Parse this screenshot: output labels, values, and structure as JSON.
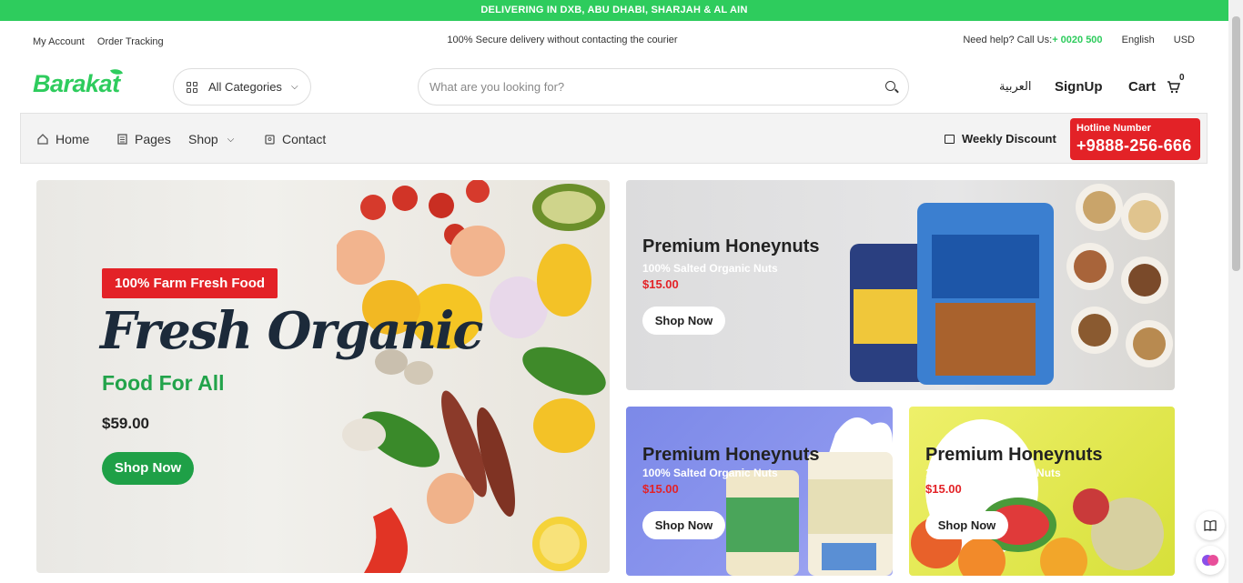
{
  "announcement": "DELIVERING IN DXB, ABU DHABI, SHARJAH & AL AIN",
  "topbar": {
    "my_account": "My Account",
    "order_tracking": "Order Tracking",
    "secure_text": "100% Secure delivery without contacting the courier",
    "help_text": "Need help? Call Us:",
    "phone": "+ 0020 500",
    "language": "English",
    "currency": "USD"
  },
  "header": {
    "logo": "Barakat",
    "categories_label": "All Categories",
    "search_placeholder": "What are you looking for?",
    "arabic": "العربية",
    "signup": "SignUp",
    "cart": "Cart",
    "cart_count": "0"
  },
  "nav": {
    "items": [
      {
        "label": "Home",
        "icon": "home-icon"
      },
      {
        "label": "Pages",
        "icon": "pages-icon"
      },
      {
        "label": "Shop",
        "icon": "chevron-down-icon"
      },
      {
        "label": "Contact",
        "icon": "contact-icon"
      }
    ],
    "weekly_discount": "Weekly Discount",
    "hotline_label": "Hotline Number",
    "hotline_number": "+9888-256-666"
  },
  "hero": {
    "badge": "100% Farm Fresh Food",
    "title": "Fresh Organic",
    "subtitle": "Food For All",
    "price": "$59.00",
    "button": "Shop Now"
  },
  "promos": [
    {
      "title": "Premium Honeynuts",
      "subtitle": "100% Salted Organic Nuts",
      "price": "$15.00",
      "button": "Shop Now"
    },
    {
      "title": "Premium Honeynuts",
      "subtitle": "100% Salted Organic Nuts",
      "price": "$15.00",
      "button": "Shop Now"
    },
    {
      "title": "Premium Honeynuts",
      "subtitle": "100% Salted Organic Nuts",
      "price": "$15.00",
      "button": "Shop Now"
    }
  ],
  "colors": {
    "brand_green": "#2ecc5d",
    "accent_red": "#e32227",
    "dark_green": "#1fa047"
  }
}
